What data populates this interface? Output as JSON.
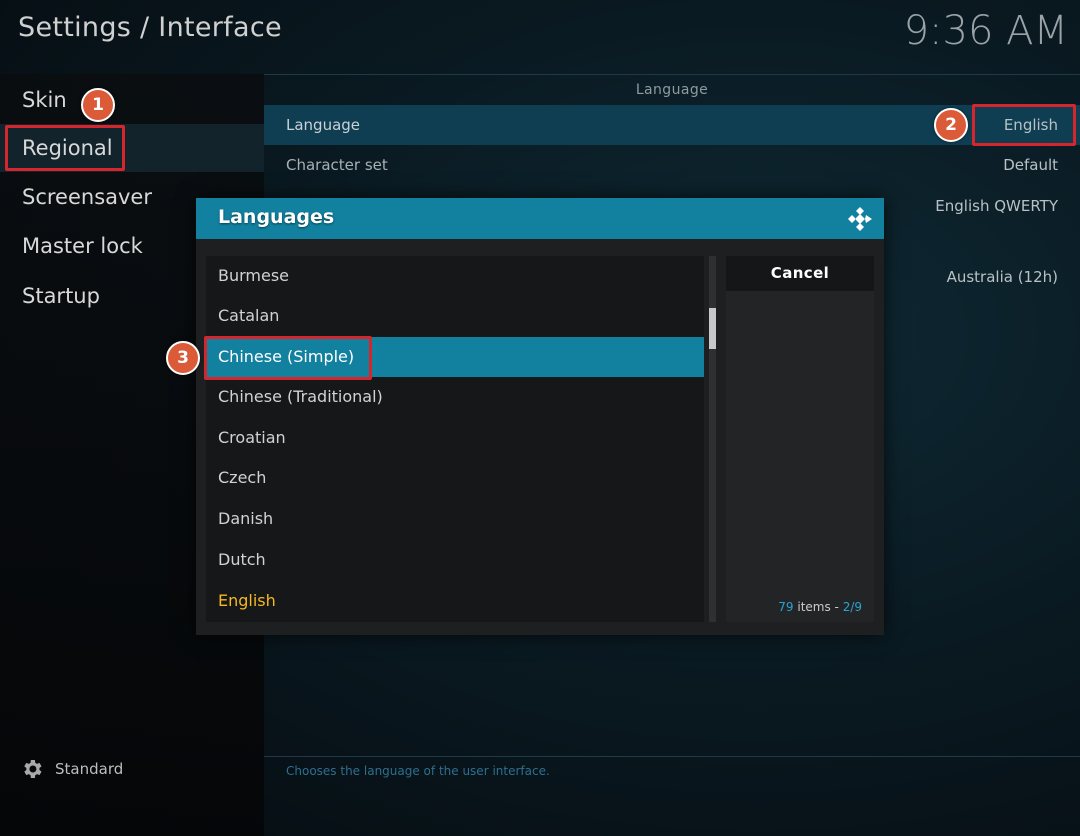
{
  "header": {
    "title": "Settings / Interface",
    "clock": "9:36 AM"
  },
  "sidebar": {
    "items": [
      {
        "label": "Skin"
      },
      {
        "label": "Regional"
      },
      {
        "label": "Screensaver"
      },
      {
        "label": "Master lock"
      },
      {
        "label": "Startup"
      }
    ],
    "active": "Regional",
    "footer_label": "Standard"
  },
  "settings": {
    "section_title": "Language",
    "rows": [
      {
        "label": "Language",
        "value": "English"
      },
      {
        "label": "Character set",
        "value": "Default"
      },
      {
        "label": "",
        "value": "English QWERTY"
      },
      {
        "label": "",
        "value": "Australia (12h)"
      }
    ],
    "help": "Chooses the language of the user interface."
  },
  "dialog": {
    "title": "Languages",
    "items": [
      {
        "label": "Burmese"
      },
      {
        "label": "Catalan"
      },
      {
        "label": "Chinese (Simple)"
      },
      {
        "label": "Chinese (Traditional)"
      },
      {
        "label": "Croatian"
      },
      {
        "label": "Czech"
      },
      {
        "label": "Danish"
      },
      {
        "label": "Dutch"
      },
      {
        "label": "English"
      }
    ],
    "focused_item": "Chinese (Simple)",
    "current_item": "English",
    "cancel_label": "Cancel",
    "count_number": "79",
    "count_text": " items - ",
    "page": "2/9"
  },
  "annotations": {
    "badges": [
      "1",
      "2",
      "3"
    ],
    "color": "#d5262d"
  },
  "colors": {
    "accent": "#12809f",
    "current": "#f5b921",
    "badge": "#db5a38"
  }
}
